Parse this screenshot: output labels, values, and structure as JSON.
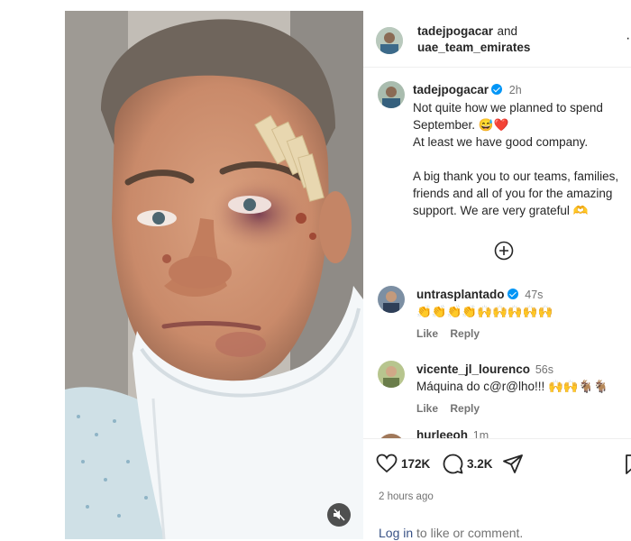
{
  "post": {
    "authors": {
      "primary": "tadejpogacar",
      "conjunction": "and",
      "secondary": "uae_team_emirates"
    },
    "caption": {
      "username": "tadejpogacar",
      "time": "2h",
      "text": "Not quite how we planned to spend September. 😅❤️\nAt least we have good company.\n\nA big thank you to our teams, families, friends and all of you for the amazing support. We are very grateful 🫶"
    },
    "load_more_icon": "plus-circle-icon",
    "comments": [
      {
        "username": "untrasplantado",
        "verified": true,
        "time": "47s",
        "text": "👏👏👏👏🙌🙌🙌🙌🙌",
        "like_label": "Like",
        "reply_label": "Reply"
      },
      {
        "username": "vicente_jl_lourenco",
        "verified": false,
        "time": "56s",
        "text": "Máquina do c@r@lho!!! 🙌🙌🐐🐐",
        "like_label": "Like",
        "reply_label": "Reply"
      },
      {
        "username": "hurleeoh",
        "verified": false,
        "time": "1m"
      }
    ],
    "stats": {
      "likes": "172K",
      "comments": "3.2K"
    },
    "posted_ago": "2 hours ago",
    "login": {
      "link": "Log in",
      "rest": " to like or comment."
    }
  },
  "colors": {
    "verified": "#0095f6",
    "link": "#385185",
    "meta": "#737373"
  }
}
